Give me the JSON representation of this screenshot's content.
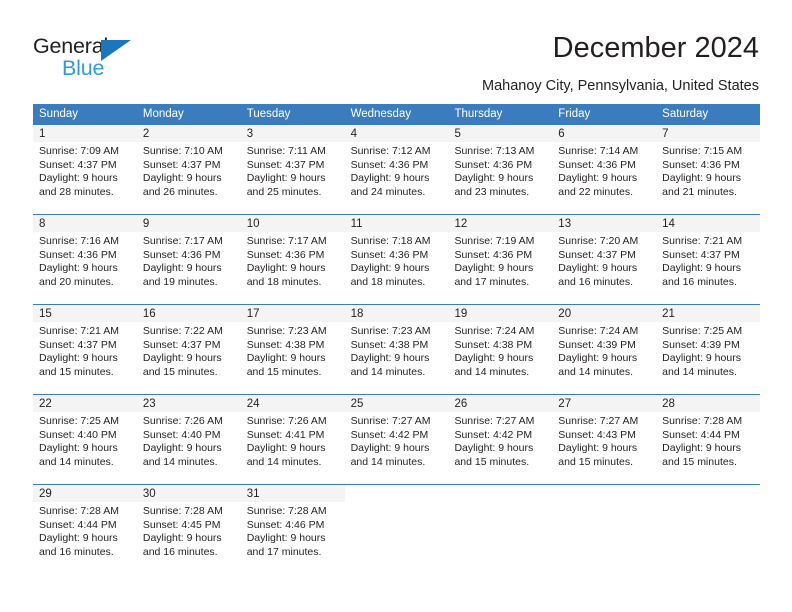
{
  "brand": {
    "name_top": "General",
    "name_bottom": "Blue",
    "accent_color": "#1b76bc",
    "accent_color_light": "#2e9be0"
  },
  "header": {
    "title": "December 2024",
    "subtitle": "Mahanoy City, Pennsylvania, United States"
  },
  "calendar": {
    "header_bg": "#3b7cbf",
    "daynum_bg": "#f4f4f4",
    "weekdays": [
      "Sunday",
      "Monday",
      "Tuesday",
      "Wednesday",
      "Thursday",
      "Friday",
      "Saturday"
    ],
    "weeks": [
      [
        {
          "day": "1",
          "sunrise": "Sunrise: 7:09 AM",
          "sunset": "Sunset: 4:37 PM",
          "daylight1": "Daylight: 9 hours",
          "daylight2": "and 28 minutes."
        },
        {
          "day": "2",
          "sunrise": "Sunrise: 7:10 AM",
          "sunset": "Sunset: 4:37 PM",
          "daylight1": "Daylight: 9 hours",
          "daylight2": "and 26 minutes."
        },
        {
          "day": "3",
          "sunrise": "Sunrise: 7:11 AM",
          "sunset": "Sunset: 4:37 PM",
          "daylight1": "Daylight: 9 hours",
          "daylight2": "and 25 minutes."
        },
        {
          "day": "4",
          "sunrise": "Sunrise: 7:12 AM",
          "sunset": "Sunset: 4:36 PM",
          "daylight1": "Daylight: 9 hours",
          "daylight2": "and 24 minutes."
        },
        {
          "day": "5",
          "sunrise": "Sunrise: 7:13 AM",
          "sunset": "Sunset: 4:36 PM",
          "daylight1": "Daylight: 9 hours",
          "daylight2": "and 23 minutes."
        },
        {
          "day": "6",
          "sunrise": "Sunrise: 7:14 AM",
          "sunset": "Sunset: 4:36 PM",
          "daylight1": "Daylight: 9 hours",
          "daylight2": "and 22 minutes."
        },
        {
          "day": "7",
          "sunrise": "Sunrise: 7:15 AM",
          "sunset": "Sunset: 4:36 PM",
          "daylight1": "Daylight: 9 hours",
          "daylight2": "and 21 minutes."
        }
      ],
      [
        {
          "day": "8",
          "sunrise": "Sunrise: 7:16 AM",
          "sunset": "Sunset: 4:36 PM",
          "daylight1": "Daylight: 9 hours",
          "daylight2": "and 20 minutes."
        },
        {
          "day": "9",
          "sunrise": "Sunrise: 7:17 AM",
          "sunset": "Sunset: 4:36 PM",
          "daylight1": "Daylight: 9 hours",
          "daylight2": "and 19 minutes."
        },
        {
          "day": "10",
          "sunrise": "Sunrise: 7:17 AM",
          "sunset": "Sunset: 4:36 PM",
          "daylight1": "Daylight: 9 hours",
          "daylight2": "and 18 minutes."
        },
        {
          "day": "11",
          "sunrise": "Sunrise: 7:18 AM",
          "sunset": "Sunset: 4:36 PM",
          "daylight1": "Daylight: 9 hours",
          "daylight2": "and 18 minutes."
        },
        {
          "day": "12",
          "sunrise": "Sunrise: 7:19 AM",
          "sunset": "Sunset: 4:36 PM",
          "daylight1": "Daylight: 9 hours",
          "daylight2": "and 17 minutes."
        },
        {
          "day": "13",
          "sunrise": "Sunrise: 7:20 AM",
          "sunset": "Sunset: 4:37 PM",
          "daylight1": "Daylight: 9 hours",
          "daylight2": "and 16 minutes."
        },
        {
          "day": "14",
          "sunrise": "Sunrise: 7:21 AM",
          "sunset": "Sunset: 4:37 PM",
          "daylight1": "Daylight: 9 hours",
          "daylight2": "and 16 minutes."
        }
      ],
      [
        {
          "day": "15",
          "sunrise": "Sunrise: 7:21 AM",
          "sunset": "Sunset: 4:37 PM",
          "daylight1": "Daylight: 9 hours",
          "daylight2": "and 15 minutes."
        },
        {
          "day": "16",
          "sunrise": "Sunrise: 7:22 AM",
          "sunset": "Sunset: 4:37 PM",
          "daylight1": "Daylight: 9 hours",
          "daylight2": "and 15 minutes."
        },
        {
          "day": "17",
          "sunrise": "Sunrise: 7:23 AM",
          "sunset": "Sunset: 4:38 PM",
          "daylight1": "Daylight: 9 hours",
          "daylight2": "and 15 minutes."
        },
        {
          "day": "18",
          "sunrise": "Sunrise: 7:23 AM",
          "sunset": "Sunset: 4:38 PM",
          "daylight1": "Daylight: 9 hours",
          "daylight2": "and 14 minutes."
        },
        {
          "day": "19",
          "sunrise": "Sunrise: 7:24 AM",
          "sunset": "Sunset: 4:38 PM",
          "daylight1": "Daylight: 9 hours",
          "daylight2": "and 14 minutes."
        },
        {
          "day": "20",
          "sunrise": "Sunrise: 7:24 AM",
          "sunset": "Sunset: 4:39 PM",
          "daylight1": "Daylight: 9 hours",
          "daylight2": "and 14 minutes."
        },
        {
          "day": "21",
          "sunrise": "Sunrise: 7:25 AM",
          "sunset": "Sunset: 4:39 PM",
          "daylight1": "Daylight: 9 hours",
          "daylight2": "and 14 minutes."
        }
      ],
      [
        {
          "day": "22",
          "sunrise": "Sunrise: 7:25 AM",
          "sunset": "Sunset: 4:40 PM",
          "daylight1": "Daylight: 9 hours",
          "daylight2": "and 14 minutes."
        },
        {
          "day": "23",
          "sunrise": "Sunrise: 7:26 AM",
          "sunset": "Sunset: 4:40 PM",
          "daylight1": "Daylight: 9 hours",
          "daylight2": "and 14 minutes."
        },
        {
          "day": "24",
          "sunrise": "Sunrise: 7:26 AM",
          "sunset": "Sunset: 4:41 PM",
          "daylight1": "Daylight: 9 hours",
          "daylight2": "and 14 minutes."
        },
        {
          "day": "25",
          "sunrise": "Sunrise: 7:27 AM",
          "sunset": "Sunset: 4:42 PM",
          "daylight1": "Daylight: 9 hours",
          "daylight2": "and 14 minutes."
        },
        {
          "day": "26",
          "sunrise": "Sunrise: 7:27 AM",
          "sunset": "Sunset: 4:42 PM",
          "daylight1": "Daylight: 9 hours",
          "daylight2": "and 15 minutes."
        },
        {
          "day": "27",
          "sunrise": "Sunrise: 7:27 AM",
          "sunset": "Sunset: 4:43 PM",
          "daylight1": "Daylight: 9 hours",
          "daylight2": "and 15 minutes."
        },
        {
          "day": "28",
          "sunrise": "Sunrise: 7:28 AM",
          "sunset": "Sunset: 4:44 PM",
          "daylight1": "Daylight: 9 hours",
          "daylight2": "and 15 minutes."
        }
      ],
      [
        {
          "day": "29",
          "sunrise": "Sunrise: 7:28 AM",
          "sunset": "Sunset: 4:44 PM",
          "daylight1": "Daylight: 9 hours",
          "daylight2": "and 16 minutes."
        },
        {
          "day": "30",
          "sunrise": "Sunrise: 7:28 AM",
          "sunset": "Sunset: 4:45 PM",
          "daylight1": "Daylight: 9 hours",
          "daylight2": "and 16 minutes."
        },
        {
          "day": "31",
          "sunrise": "Sunrise: 7:28 AM",
          "sunset": "Sunset: 4:46 PM",
          "daylight1": "Daylight: 9 hours",
          "daylight2": "and 17 minutes."
        },
        {
          "day": "",
          "sunrise": "",
          "sunset": "",
          "daylight1": "",
          "daylight2": ""
        },
        {
          "day": "",
          "sunrise": "",
          "sunset": "",
          "daylight1": "",
          "daylight2": ""
        },
        {
          "day": "",
          "sunrise": "",
          "sunset": "",
          "daylight1": "",
          "daylight2": ""
        },
        {
          "day": "",
          "sunrise": "",
          "sunset": "",
          "daylight1": "",
          "daylight2": ""
        }
      ]
    ]
  }
}
